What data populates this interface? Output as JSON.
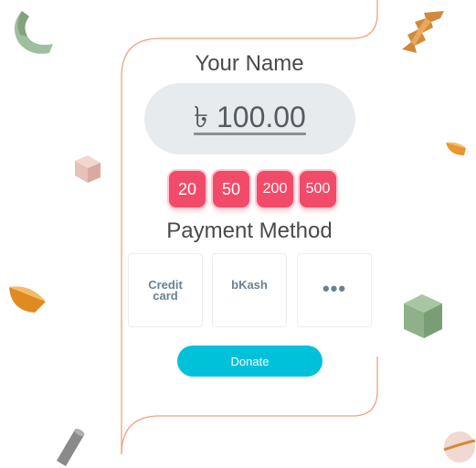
{
  "header": {
    "title": "Your Name"
  },
  "amount": {
    "display": "৳ 100.00"
  },
  "presets": [
    "20",
    "50",
    "200",
    "500"
  ],
  "payment": {
    "title": "Payment Method",
    "methods": [
      "Credit card",
      "bKash"
    ],
    "more_label": "•••"
  },
  "donate_label": "Donate",
  "colors": {
    "accent": "#f24a69",
    "donate": "#00c1da",
    "frame": "#f2a17f",
    "amount_bg": "#e8ebee"
  }
}
